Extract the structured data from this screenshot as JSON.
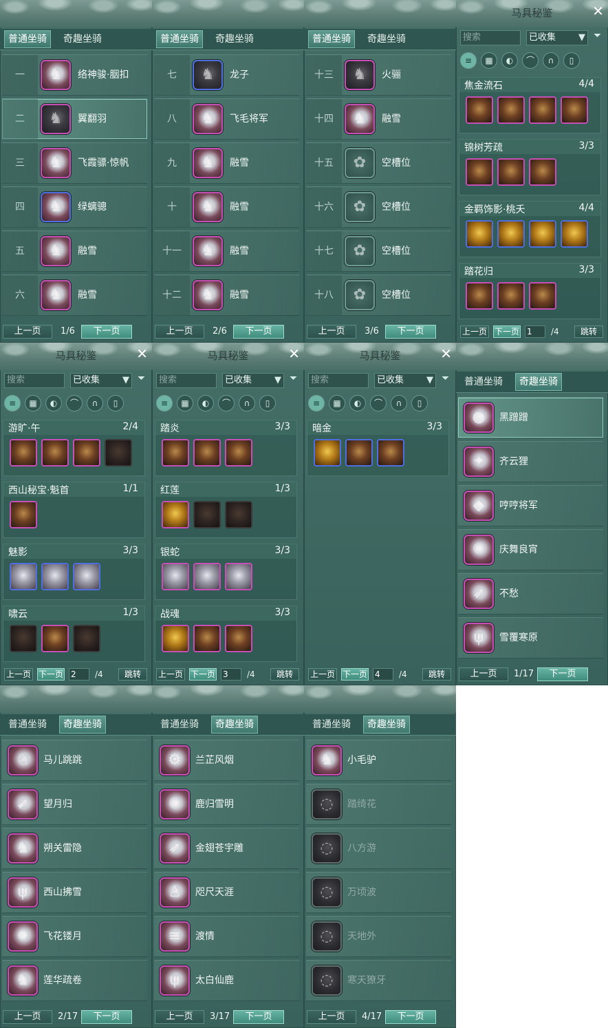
{
  "colors": {
    "panel_bg": "#3f6962",
    "tab_active": "#5f9a8f",
    "rarity_purple": "#c54fb4",
    "rarity_blue": "#4f6ee0",
    "button_highlight": "#69b6a6"
  },
  "stable_panels": [
    {
      "tabs": [
        "普通坐骑",
        "奇趣坐骑"
      ],
      "active_tab": 0,
      "labels": [
        "一",
        "二",
        "三",
        "四",
        "五",
        "六"
      ],
      "names": [
        "络神骏·胭扣",
        "翼翻羽",
        "飞霞骠·惊帆",
        "绿螭骢",
        "融雪",
        "融雪"
      ],
      "icons": [
        "horse-white",
        "horse-black",
        "horse-white",
        "horse-brown",
        "horse-white",
        "horse-white"
      ],
      "rarity": [
        "purple",
        "purple",
        "purple",
        "blue",
        "purple",
        "purple"
      ],
      "page": "1/6",
      "prev": "上一页",
      "next": "下一页",
      "next_hi": true
    },
    {
      "tabs": [
        "普通坐骑",
        "奇趣坐骑"
      ],
      "active_tab": 0,
      "labels": [
        "七",
        "八",
        "九",
        "十",
        "十一",
        "十二"
      ],
      "names": [
        "龙子",
        "飞毛将军",
        "融雪",
        "融雪",
        "融雪",
        "融雪"
      ],
      "icons": [
        "horse-black",
        "horse-gold",
        "horse-white",
        "horse-white",
        "horse-white",
        "horse-white"
      ],
      "rarity": [
        "blue",
        "purple",
        "purple",
        "purple",
        "purple",
        "purple"
      ],
      "page": "2/6",
      "prev": "上一页",
      "next": "下一页",
      "next_hi": true
    },
    {
      "tabs": [
        "普通坐骑",
        "奇趣坐骑"
      ],
      "active_tab": 0,
      "labels": [
        "十三",
        "十四",
        "十五",
        "十六",
        "十七",
        "十八"
      ],
      "names": [
        "火骊",
        "融雪",
        "空槽位",
        "空槽位",
        "空槽位",
        "空槽位"
      ],
      "icons": [
        "horse-dark",
        "horse-white",
        "empty-slot",
        "empty-slot",
        "empty-slot",
        "empty-slot"
      ],
      "rarity": [
        "purple",
        "purple",
        "empty",
        "empty",
        "empty",
        "empty"
      ],
      "page": "3/6",
      "prev": "上一页",
      "next": "下一页",
      "next_hi": true
    }
  ],
  "collection_panels": [
    {
      "title": "马具秘鉴",
      "search_placeholder": "搜索",
      "filter_value": "已收集",
      "groups": [
        {
          "name": "焦金流石",
          "count": "4/4",
          "items": [
            "mask",
            "saddle",
            "reins",
            "ornament"
          ]
        },
        {
          "name": "锦树芳疏",
          "count": "3/3",
          "items": [
            "mask",
            "saddle",
            "ornament"
          ]
        },
        {
          "name": "金羁饰影·桃夭",
          "count": "4/4",
          "items": [
            "bell",
            "necklace",
            "ring",
            "bangle"
          ]
        },
        {
          "name": "踏花归",
          "count": "3/3",
          "items": [
            "reins",
            "saddle",
            "armor"
          ]
        }
      ],
      "prev": "上一页",
      "next": "下一页",
      "page_input": "1",
      "total": "/4",
      "jump": "跳转"
    },
    {
      "title": "马具秘鉴",
      "search_placeholder": "搜索",
      "filter_value": "已收集",
      "groups": [
        {
          "name": "游旷·午",
          "count": "2/4",
          "items": [
            "mask",
            "saddle",
            "armor",
            "armor-dark"
          ]
        },
        {
          "name": "西山秘宝·魁首",
          "count": "1/1",
          "items": [
            "book"
          ]
        },
        {
          "name": "魅影",
          "count": "3/3",
          "items": [
            "silver-mask",
            "silver-armor",
            "silver-armor"
          ]
        },
        {
          "name": "啸云",
          "count": "1/3",
          "items": [
            "mask-dark",
            "armor",
            "armor-dark"
          ]
        }
      ],
      "prev": "上一页",
      "next": "下一页",
      "page_input": "2",
      "total": "/4",
      "jump": "跳转"
    },
    {
      "title": "马具秘鉴",
      "search_placeholder": "搜索",
      "filter_value": "已收集",
      "groups": [
        {
          "name": "踏炎",
          "count": "3/3",
          "items": [
            "reins",
            "saddle",
            "armor"
          ]
        },
        {
          "name": "红莲",
          "count": "1/3",
          "items": [
            "gold-reins",
            "saddle-dark",
            "armor-dark"
          ]
        },
        {
          "name": "银蛇",
          "count": "3/3",
          "items": [
            "silver-mask",
            "silver-armor",
            "silver-armor"
          ]
        },
        {
          "name": "战魂",
          "count": "3/3",
          "items": [
            "gold-reins",
            "saddle",
            "armor"
          ]
        }
      ],
      "prev": "上一页",
      "next": "下一页",
      "page_input": "3",
      "total": "/4",
      "jump": "跳转"
    },
    {
      "title": "马具秘鉴",
      "search_placeholder": "搜索",
      "filter_value": "已收集",
      "groups": [
        {
          "name": "暗金",
          "count": "3/3",
          "items": [
            "gold-reins",
            "saddle",
            "armor"
          ]
        }
      ],
      "prev": "上一页",
      "next": "下一页",
      "page_input": "4",
      "total": "/4",
      "jump": "跳转"
    }
  ],
  "fun_panels": [
    {
      "tabs": [
        "普通坐骑",
        "奇趣坐骑"
      ],
      "active_tab": 1,
      "names": [
        "黑蹭蹭",
        "齐云狸",
        "哼哼将军",
        "庆舞良宵",
        "不愁",
        "雪覆寒原"
      ],
      "icons": [
        "bear",
        "cat",
        "pig",
        "lion-dance",
        "bird",
        "white-deer"
      ],
      "page": "1/17",
      "prev": "上一页",
      "next": "下一页"
    },
    {
      "tabs": [
        "普通坐骑",
        "奇趣坐骑"
      ],
      "active_tab": 1,
      "names": [
        "马儿跳跳",
        "望月归",
        "朔关雷隐",
        "西山拂雪",
        "飞花镂月",
        "莲华疏卷"
      ],
      "icons": [
        "toy-horse",
        "crane",
        "wolf",
        "deer",
        "golden-wheel",
        "white-horse"
      ],
      "page": "2/17",
      "prev": "上一页",
      "next": "下一页"
    },
    {
      "tabs": [
        "普通坐骑",
        "奇趣坐骑"
      ],
      "active_tab": 1,
      "names": [
        "兰芷风烟",
        "鹿归雪明",
        "金翅苍宇雕",
        "咫尺天涯",
        "渡情",
        "太白仙鹿"
      ],
      "icons": [
        "machine",
        "lion-dance",
        "eagle",
        "puppet",
        "bamboo-raft",
        "antlers"
      ],
      "page": "3/17",
      "prev": "上一页",
      "next": "下一页"
    },
    {
      "tabs": [
        "普通坐骑",
        "奇趣坐骑"
      ],
      "active_tab": 1,
      "names": [
        "小毛驴",
        "踏绮花",
        "八方游",
        "万顷波",
        "天地外",
        "寒天獠牙"
      ],
      "icons": [
        "donkey",
        "locked",
        "locked",
        "locked",
        "locked",
        "locked"
      ],
      "locked": [
        false,
        true,
        true,
        true,
        true,
        true
      ],
      "page": "4/17",
      "prev": "上一页",
      "next": "下一页"
    }
  ],
  "cat_icons": [
    "list-icon",
    "grid-icon",
    "head-icon",
    "saddle-icon",
    "horseshoe-icon",
    "armor-icon"
  ]
}
